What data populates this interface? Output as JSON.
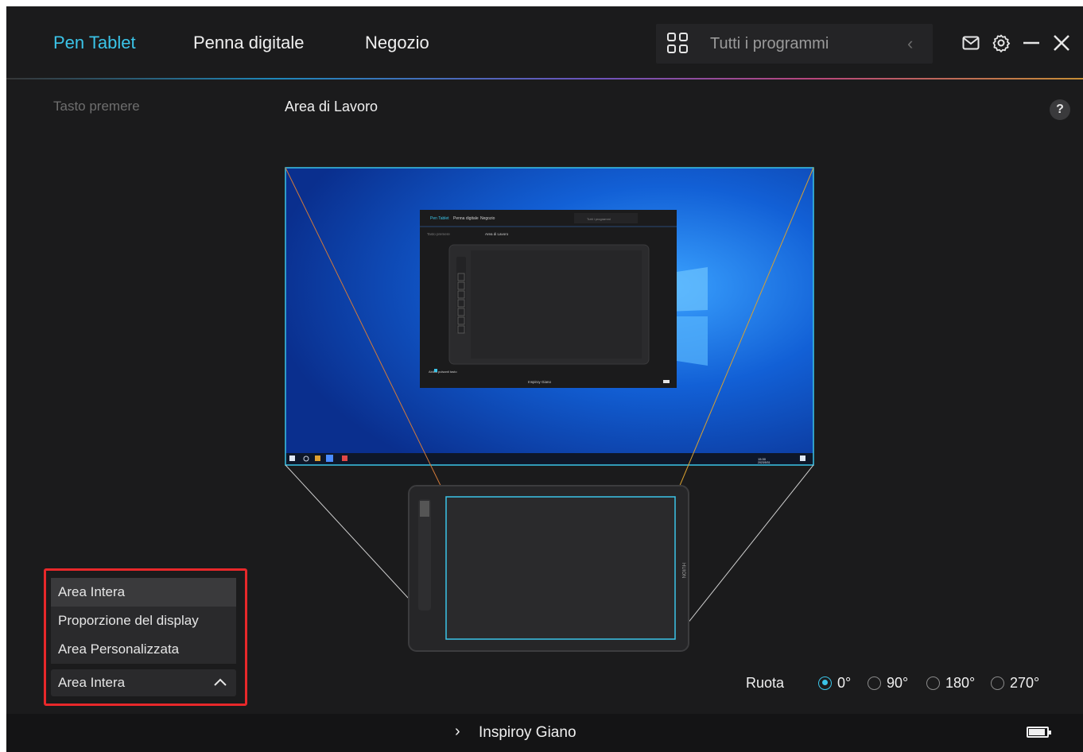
{
  "header": {
    "tabs": [
      {
        "label": "Pen Tablet",
        "active": true
      },
      {
        "label": "Penna digitale",
        "active": false
      },
      {
        "label": "Negozio",
        "active": false
      }
    ],
    "programs_label": "Tutti i programmi"
  },
  "content": {
    "side_label": "Tasto premere",
    "section_title": "Area di Lavoro",
    "help_label": "?"
  },
  "preview": {
    "mini_app": {
      "tabs": [
        "Pen Tablet",
        "Penna digitale",
        "Negozio"
      ],
      "programs_label": "Tutti i programmi",
      "side_label": "Tasto premere",
      "section_title": "Area di Lavoro",
      "checkbox_label": "Abilita pulsanti tasto",
      "device_name": "Inspiroy Giano"
    },
    "taskbar_time": "15:30",
    "taskbar_date": "2023/5/31",
    "tablet_brand": "HUION"
  },
  "area_dropdown": {
    "options": [
      "Area Intera",
      "Proporzione del display",
      "Area Personalizzata"
    ],
    "selected": "Area Intera"
  },
  "rotation": {
    "label": "Ruota",
    "options": [
      "0°",
      "90°",
      "180°",
      "270°"
    ],
    "selected": "0°"
  },
  "footer": {
    "device_name": "Inspiroy Giano"
  },
  "colors": {
    "accent": "#3bc4e8",
    "highlight_border": "#e8282a",
    "background": "#1b1b1c"
  }
}
